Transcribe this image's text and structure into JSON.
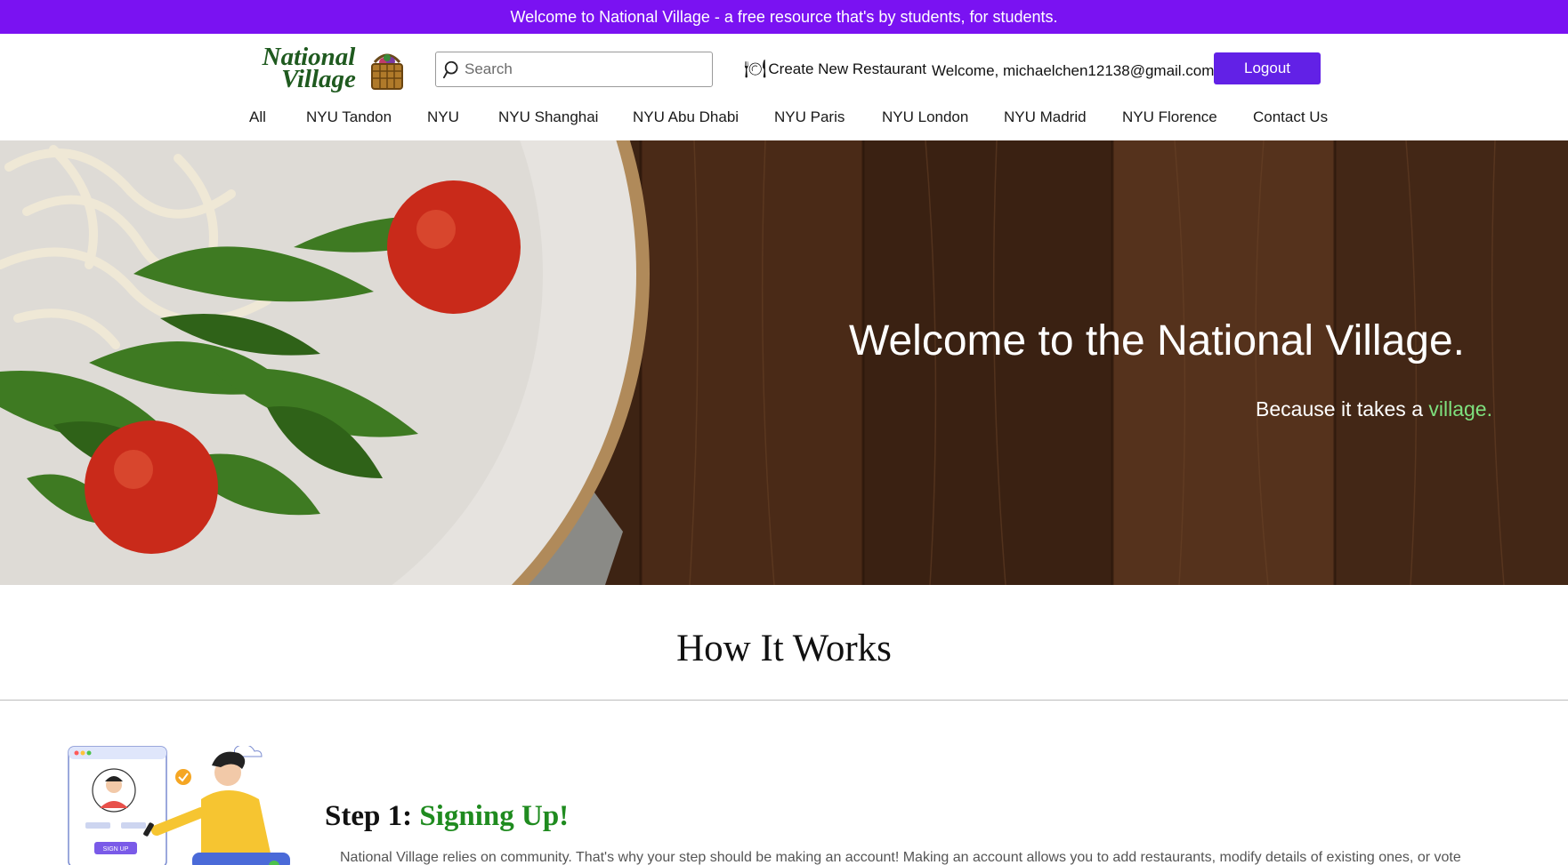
{
  "announcement": "Welcome to National Village - a free resource that's by students, for students.",
  "header": {
    "logo_line1": "National",
    "logo_line2": "Village",
    "search_placeholder": "Search",
    "create_link": "Create New Restaurant",
    "welcome_text": "Welcome, michaelchen12138@gmail.com",
    "logout_label": "Logout"
  },
  "nav": {
    "items": [
      "All",
      "NYU Tandon",
      "NYU",
      "NYU Shanghai",
      "NYU Abu Dhabi",
      "NYU Paris",
      "NYU London",
      "NYU Madrid",
      "NYU Florence",
      "Contact Us"
    ]
  },
  "hero": {
    "title": "Welcome to the National Village.",
    "subtitle_prefix": "Because it takes a ",
    "subtitle_accent": "village."
  },
  "how_it_works": {
    "title": "How It Works"
  },
  "step1": {
    "prefix": "Step 1: ",
    "title": "Signing Up!",
    "illustration_button": "SIGN UP",
    "text": "National Village relies on community. That's why your step should be making an account! Making an account allows you to add restaurants, modify details of existing ones, or vote"
  },
  "colors": {
    "announce_bg": "#7a12f2",
    "logout_bg": "#6221e6",
    "accent_green": "#7ee07e",
    "step_green": "#1f8b1f"
  }
}
